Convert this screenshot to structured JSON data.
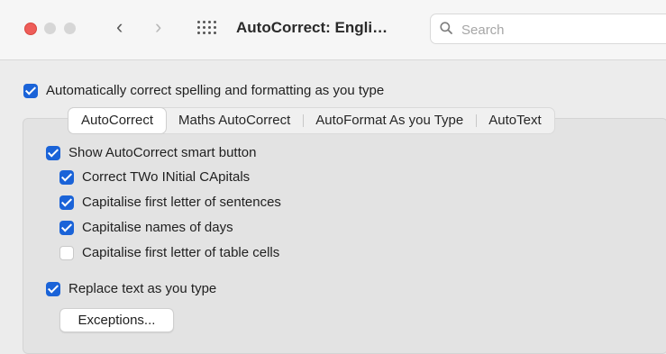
{
  "window": {
    "title": "AutoCorrect: Engli…",
    "nav_back": "‹",
    "nav_forward": "›"
  },
  "search": {
    "placeholder": "Search",
    "value": ""
  },
  "master_option": {
    "label": "Automatically correct spelling and formatting as you type",
    "checked": true
  },
  "tabs": [
    {
      "label": "AutoCorrect",
      "selected": true
    },
    {
      "label": "Maths AutoCorrect",
      "selected": false
    },
    {
      "label": "AutoFormat As you Type",
      "selected": false
    },
    {
      "label": "AutoText",
      "selected": false
    }
  ],
  "options": [
    {
      "label": "Show AutoCorrect smart button",
      "checked": true
    },
    {
      "label": "Correct TWo INitial CApitals",
      "checked": true
    },
    {
      "label": "Capitalise first letter of sentences",
      "checked": true
    },
    {
      "label": "Capitalise names of days",
      "checked": true
    },
    {
      "label": "Capitalise first letter of table cells",
      "checked": false
    },
    {
      "label": "Replace text as you type",
      "checked": true
    }
  ],
  "exceptions_button": {
    "label": "Exceptions..."
  },
  "colors": {
    "accent": "#1a63d8",
    "close_button": "#ee5d59"
  },
  "icons": {
    "close": "close-icon",
    "back": "chevron-left-icon",
    "forward": "chevron-right-icon",
    "grid": "grid-icon",
    "search": "search-icon"
  }
}
